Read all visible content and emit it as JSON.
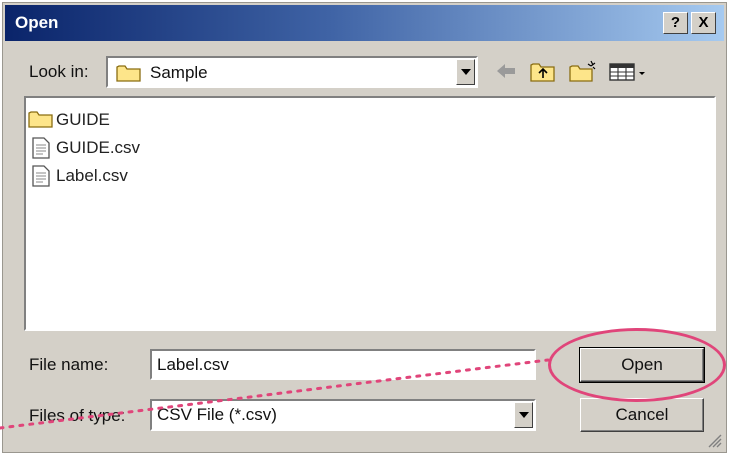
{
  "window": {
    "title": "Open",
    "help_glyph": "?",
    "close_glyph": "X"
  },
  "look_in": {
    "label": "Look in:",
    "value": "Sample"
  },
  "toolbar": {
    "icons": [
      "back-arrow-icon",
      "up-folder-icon",
      "new-folder-icon",
      "view-menu-icon"
    ]
  },
  "files": [
    {
      "name": "GUIDE",
      "type": "folder"
    },
    {
      "name": "GUIDE.csv",
      "type": "file"
    },
    {
      "name": "Label.csv",
      "type": "file"
    }
  ],
  "file_name": {
    "label": "File name:",
    "value": "Label.csv"
  },
  "file_type": {
    "label": "Files of type:",
    "value": "CSV File (*.csv)"
  },
  "buttons": {
    "open": "Open",
    "cancel": "Cancel"
  },
  "colors": {
    "title_bar": "#0a246a",
    "dialog_bg": "#d4d0c8",
    "highlight": "#e0457a"
  }
}
